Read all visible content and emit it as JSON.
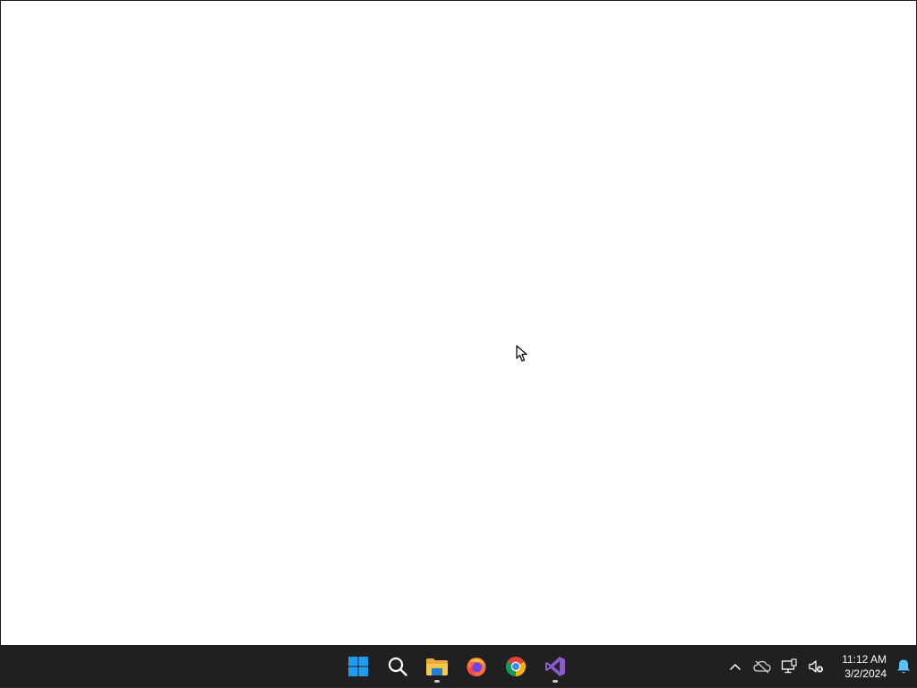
{
  "desktop": {
    "window_area": "blank-white-window"
  },
  "taskbar": {
    "pinned": [
      {
        "name": "Start",
        "icon": "windows-logo-icon",
        "running": false
      },
      {
        "name": "Search",
        "icon": "search-icon",
        "running": false
      },
      {
        "name": "File Explorer",
        "icon": "folder-icon",
        "running": true
      },
      {
        "name": "Firefox",
        "icon": "firefox-icon",
        "running": false
      },
      {
        "name": "Google Chrome",
        "icon": "chrome-icon",
        "running": false
      },
      {
        "name": "Visual Studio",
        "icon": "visual-studio-icon",
        "running": true
      }
    ],
    "tray": {
      "overflow_icon": "chevron-up-icon",
      "onedrive_icon": "cloud-offline-icon",
      "network_icon": "network-icon",
      "volume_icon": "speaker-muted-icon",
      "notification_icon": "bell-icon"
    },
    "clock": {
      "time": "11:12 AM",
      "date": "3/2/2024"
    }
  },
  "colors": {
    "taskbar_bg": "#202020",
    "windows_blue": "#1f9cf0",
    "folder_yellow": "#f7c948",
    "firefox_orange": "#ff7139",
    "vs_purple": "#8a5cc7",
    "bell_blue": "#59c2ff"
  }
}
